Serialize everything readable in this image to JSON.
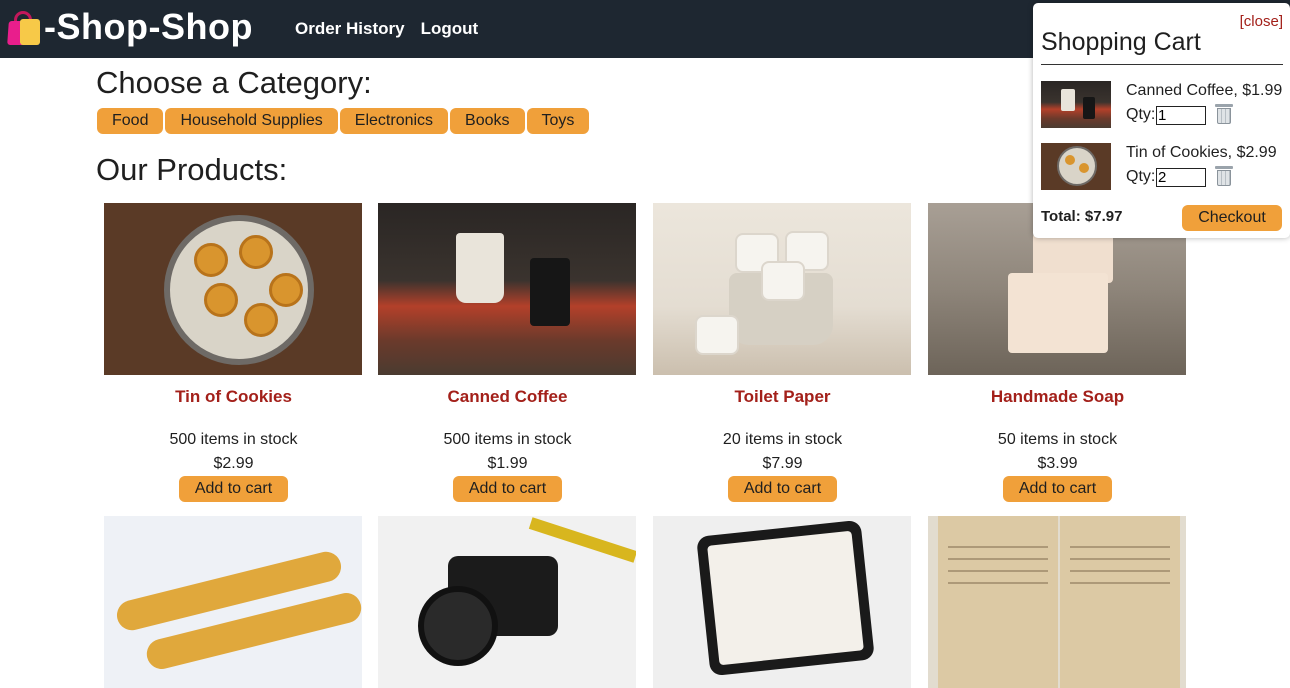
{
  "brand": {
    "title": "-Shop-Shop",
    "icon": "shopping-bags-icon"
  },
  "nav": [
    {
      "label": "Order History"
    },
    {
      "label": "Logout"
    }
  ],
  "categories": {
    "heading": "Choose a Category:",
    "items": [
      "Food",
      "Household Supplies",
      "Electronics",
      "Books",
      "Toys"
    ]
  },
  "products": {
    "heading": "Our Products:",
    "add_label": "Add to cart",
    "items": [
      {
        "name": "Tin of Cookies",
        "stock": "500 items in stock",
        "price": "$2.99",
        "image": "cookie-tin-image"
      },
      {
        "name": "Canned Coffee",
        "stock": "500 items in stock",
        "price": "$1.99",
        "image": "canned-coffee-image"
      },
      {
        "name": "Toilet Paper",
        "stock": "20 items in stock",
        "price": "$7.99",
        "image": "toilet-paper-image"
      },
      {
        "name": "Handmade Soap",
        "stock": "50 items in stock",
        "price": "$3.99",
        "image": "soap-image"
      },
      {
        "image": "spices-spoons-image"
      },
      {
        "image": "camera-image"
      },
      {
        "image": "tablet-image"
      },
      {
        "image": "old-book-image"
      }
    ]
  },
  "cart": {
    "close_label": "[close]",
    "title": "Shopping Cart",
    "qty_label": "Qty:",
    "items": [
      {
        "title": "Canned Coffee, $1.99",
        "qty": "1"
      },
      {
        "title": "Tin of Cookies, $2.99",
        "qty": "2"
      }
    ],
    "total": "Total: $7.97",
    "checkout_label": "Checkout"
  },
  "colors": {
    "header_bg": "#1e2731",
    "accent": "#f0a03a",
    "product_name": "#a3201a"
  }
}
